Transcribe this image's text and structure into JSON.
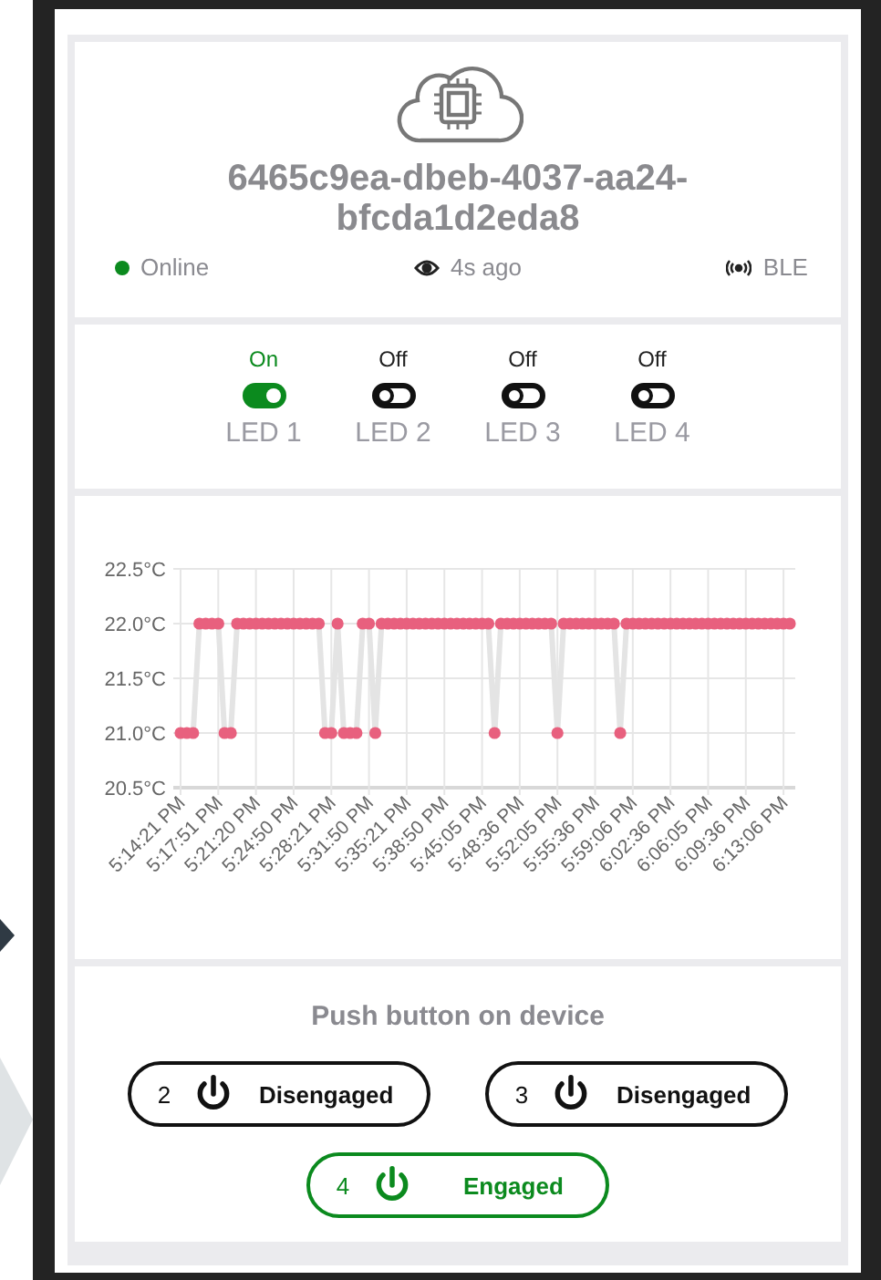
{
  "device": {
    "id": "6465c9ea-dbeb-4037-aa24-bfcda1d2eda8",
    "status": "Online",
    "online": true,
    "last_seen": "4s ago",
    "connection": "BLE"
  },
  "leds": [
    {
      "label": "LED 1",
      "state": "On",
      "on": true
    },
    {
      "label": "LED 2",
      "state": "Off",
      "on": false
    },
    {
      "label": "LED 3",
      "state": "Off",
      "on": false
    },
    {
      "label": "LED 4",
      "state": "Off",
      "on": false
    }
  ],
  "chart": {
    "chart_data": {
      "type": "line",
      "grid": true,
      "ylim": [
        20.5,
        22.5
      ],
      "yticks": [
        {
          "value": 22.5,
          "label": "22.5°C"
        },
        {
          "value": 22,
          "label": "22.0°C"
        },
        {
          "value": 21.5,
          "label": "21.5°C"
        },
        {
          "value": 21,
          "label": "21.0°C"
        },
        {
          "value": 20.5,
          "label": "20.5°C"
        }
      ],
      "categories": [
        "5:14:21 PM",
        null,
        null,
        null,
        null,
        null,
        "5:17:51 PM",
        null,
        null,
        null,
        null,
        null,
        "5:21:20 PM",
        null,
        null,
        null,
        null,
        null,
        "5:24:50 PM",
        null,
        null,
        null,
        null,
        null,
        "5:28:21 PM",
        null,
        null,
        null,
        null,
        null,
        "5:31:50 PM",
        null,
        null,
        null,
        null,
        null,
        "5:35:21 PM",
        null,
        null,
        null,
        null,
        null,
        "5:38:50 PM",
        null,
        null,
        null,
        null,
        null,
        "5:45:05 PM",
        null,
        null,
        null,
        null,
        null,
        "5:48:36 PM",
        null,
        null,
        null,
        null,
        null,
        "5:52:05 PM",
        null,
        null,
        null,
        null,
        null,
        "5:55:36 PM",
        null,
        null,
        null,
        null,
        null,
        "5:59:06 PM",
        null,
        null,
        null,
        null,
        null,
        "6:02:36 PM",
        null,
        null,
        null,
        null,
        null,
        "6:06:05 PM",
        null,
        null,
        null,
        null,
        null,
        "6:09:36 PM",
        null,
        null,
        null,
        null,
        null,
        "6:13:06 PM",
        null
      ],
      "series": [
        {
          "color": "#e8607e",
          "marker": "circle",
          "values": [
            21,
            21,
            21,
            22,
            22,
            22,
            22,
            21,
            21,
            22,
            22,
            22,
            22,
            22,
            22,
            22,
            22,
            22,
            22,
            22,
            22,
            22,
            22,
            21,
            21,
            22,
            21,
            21,
            21,
            22,
            22,
            21,
            22,
            22,
            22,
            22,
            22,
            22,
            22,
            22,
            22,
            22,
            22,
            22,
            22,
            22,
            22,
            22,
            22,
            22,
            21,
            22,
            22,
            22,
            22,
            22,
            22,
            22,
            22,
            22,
            21,
            22,
            22,
            22,
            22,
            22,
            22,
            22,
            22,
            22,
            21,
            22,
            22,
            22,
            22,
            22,
            22,
            22,
            22,
            22,
            22,
            22,
            22,
            22,
            22,
            22,
            22,
            22,
            22,
            22,
            22,
            22,
            22,
            22,
            22,
            22,
            22,
            22
          ]
        }
      ]
    }
  },
  "push_buttons": {
    "title": "Push button on device",
    "buttons": [
      {
        "number": "2",
        "label": "Disengaged",
        "engaged": false
      },
      {
        "number": "3",
        "label": "Disengaged",
        "engaged": false
      },
      {
        "number": "4",
        "label": "Engaged",
        "engaged": true
      }
    ]
  }
}
